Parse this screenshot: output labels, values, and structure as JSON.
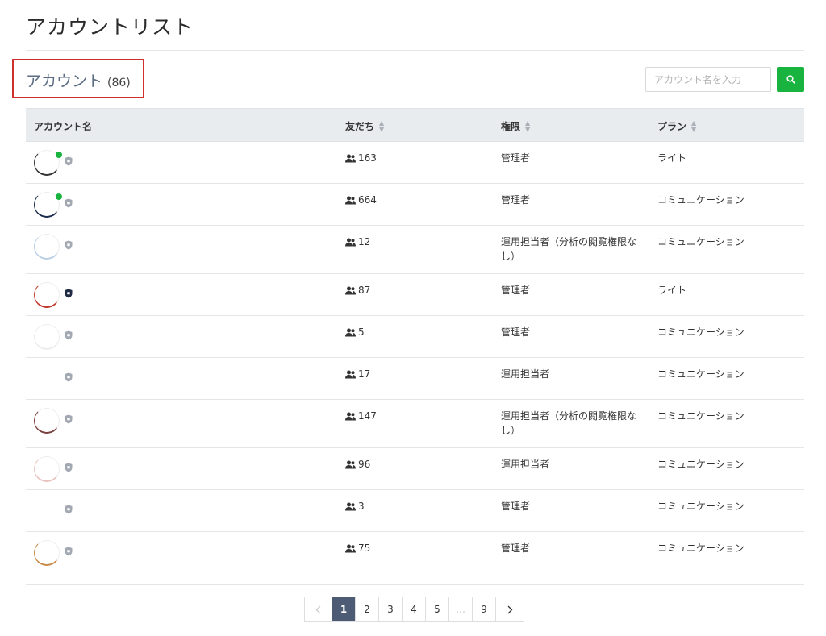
{
  "page": {
    "title": "アカウントリスト"
  },
  "section": {
    "title": "アカウント",
    "count": "(86)"
  },
  "search": {
    "placeholder": "アカウント名を入力",
    "value": ""
  },
  "table": {
    "columns": [
      {
        "label": "アカウント名",
        "sortable": false
      },
      {
        "label": "友だち",
        "sortable": true
      },
      {
        "label": "権限",
        "sortable": true
      },
      {
        "label": "プラン",
        "sortable": true
      }
    ],
    "rows": [
      {
        "friends": "163",
        "role": "管理者",
        "plan": "ライト",
        "status": "active",
        "avatar_color": "#333333",
        "badge": "gray"
      },
      {
        "friends": "664",
        "role": "管理者",
        "plan": "コミュニケーション",
        "status": "active",
        "avatar_color": "#1d2c4d",
        "badge": "gray"
      },
      {
        "friends": "12",
        "role": "運用担当者（分析の閲覧権限なし）",
        "plan": "コミュニケーション",
        "status": "",
        "avatar_color": "#b9cfe6",
        "badge": "gray"
      },
      {
        "friends": "87",
        "role": "管理者",
        "plan": "ライト",
        "status": "",
        "avatar_color": "#c0392b",
        "badge": "dark"
      },
      {
        "friends": "5",
        "role": "管理者",
        "plan": "コミュニケーション",
        "status": "",
        "avatar_color": "#ececec",
        "badge": "gray"
      },
      {
        "friends": "17",
        "role": "運用担当者",
        "plan": "コミュニケーション",
        "status": "",
        "avatar_color": "",
        "badge": "gray"
      },
      {
        "friends": "147",
        "role": "運用担当者（分析の閲覧権限なし）",
        "plan": "コミュニケーション",
        "status": "",
        "avatar_color": "#7a4040",
        "badge": "gray"
      },
      {
        "friends": "96",
        "role": "運用担当者",
        "plan": "コミュニケーション",
        "status": "",
        "avatar_color": "#e8c4bf",
        "badge": "gray"
      },
      {
        "friends": "3",
        "role": "管理者",
        "plan": "コミュニケーション",
        "status": "",
        "avatar_color": "",
        "badge": "gray"
      },
      {
        "friends": "75",
        "role": "管理者",
        "plan": "コミュニケーション",
        "status": "",
        "avatar_color": "#c98a4a",
        "badge": "gray"
      }
    ]
  },
  "pagination": {
    "prev_icon": "chevron-left-icon",
    "next_icon": "chevron-right-icon",
    "pages": [
      "1",
      "2",
      "3",
      "4",
      "5",
      "…",
      "9"
    ],
    "current": "1"
  },
  "colors": {
    "accent": "#19b33f",
    "header_bg": "#e9ecef",
    "active_page": "#4d5b74",
    "highlight": "#d0312d"
  }
}
